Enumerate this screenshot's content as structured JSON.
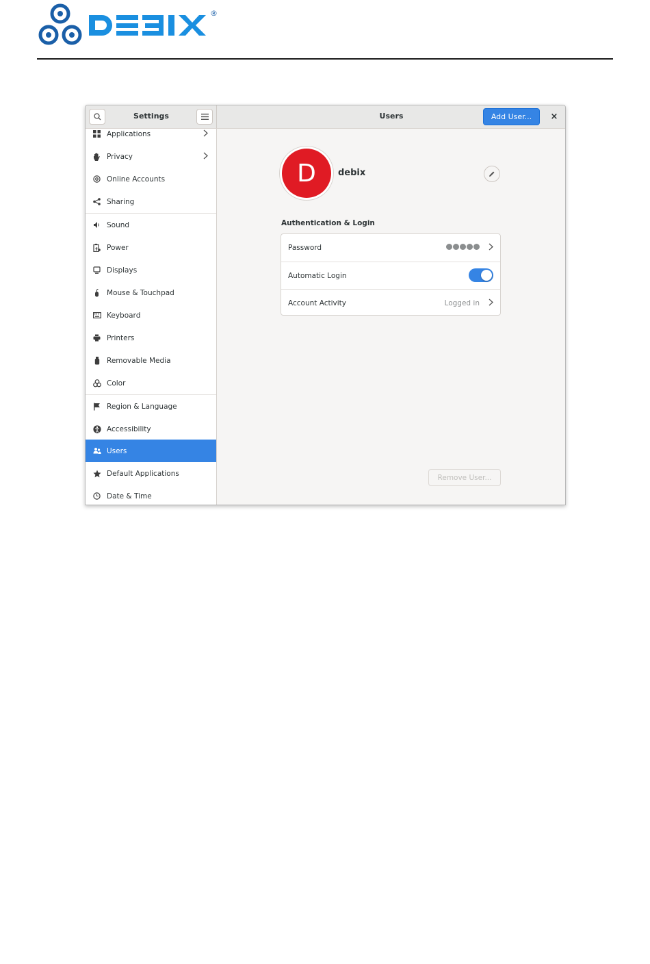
{
  "brand": {
    "logo_text": "DEBIX",
    "registered_mark": "®"
  },
  "window": {
    "sidebar_title": "Settings",
    "page_title": "Users",
    "add_user_label": "Add User...",
    "close_label": "×"
  },
  "sidebar": {
    "items": [
      {
        "label": "Applications",
        "icon": "apps-icon",
        "chevron": true
      },
      {
        "label": "Privacy",
        "icon": "hand-icon",
        "chevron": true
      },
      {
        "label": "Online Accounts",
        "icon": "at-icon",
        "chevron": false
      },
      {
        "label": "Sharing",
        "icon": "share-icon",
        "chevron": false
      },
      {
        "label": "Sound",
        "icon": "speaker-icon",
        "chevron": false
      },
      {
        "label": "Power",
        "icon": "battery-icon",
        "chevron": false
      },
      {
        "label": "Displays",
        "icon": "monitor-icon",
        "chevron": false
      },
      {
        "label": "Mouse & Touchpad",
        "icon": "mouse-icon",
        "chevron": false
      },
      {
        "label": "Keyboard",
        "icon": "keyboard-icon",
        "chevron": false
      },
      {
        "label": "Printers",
        "icon": "printer-icon",
        "chevron": false
      },
      {
        "label": "Removable Media",
        "icon": "usb-icon",
        "chevron": false
      },
      {
        "label": "Color",
        "icon": "color-icon",
        "chevron": false
      },
      {
        "label": "Region & Language",
        "icon": "flag-icon",
        "chevron": false
      },
      {
        "label": "Accessibility",
        "icon": "accessibility-icon",
        "chevron": false
      },
      {
        "label": "Users",
        "icon": "users-icon",
        "chevron": false,
        "active": true
      },
      {
        "label": "Default Applications",
        "icon": "star-icon",
        "chevron": false
      },
      {
        "label": "Date & Time",
        "icon": "clock-icon",
        "chevron": false
      }
    ]
  },
  "user": {
    "avatar_letter": "D",
    "name": "debix",
    "avatar_color": "#e01b24"
  },
  "auth": {
    "section_title": "Authentication & Login",
    "password_label": "Password",
    "automatic_login_label": "Automatic Login",
    "automatic_login_enabled": true,
    "account_activity_label": "Account Activity",
    "account_activity_value": "Logged in"
  },
  "remove_user_label": "Remove User...",
  "colors": {
    "accent": "#3584e4",
    "logo_blue": "#1a5fa8"
  }
}
